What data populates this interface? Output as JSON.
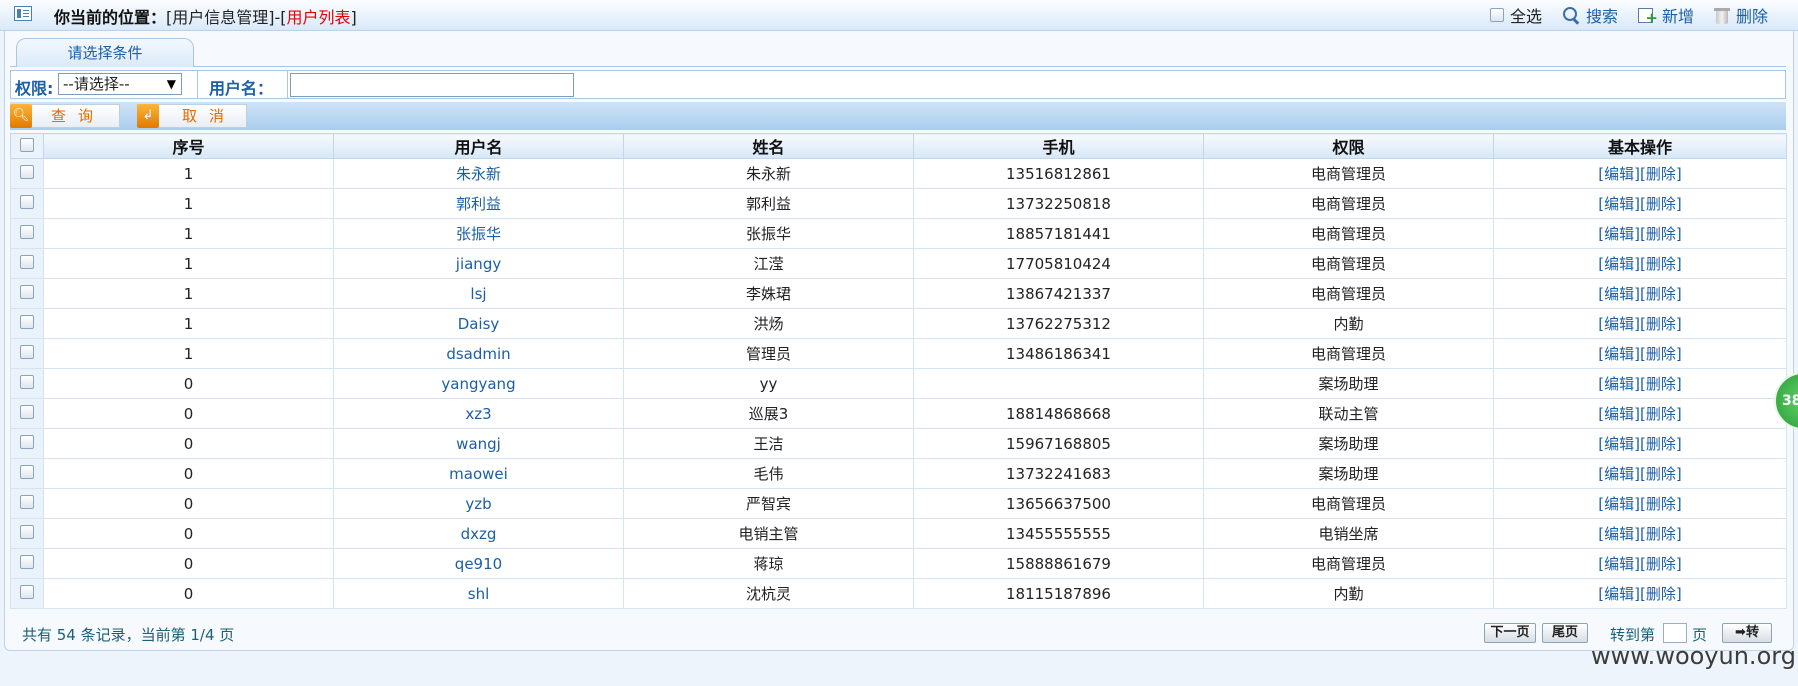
{
  "breadcrumb": {
    "prefix": "你当前的位置：",
    "path": "[用户信息管理]-[",
    "current": "用户列表",
    "suffix": "]"
  },
  "toolbar": {
    "select_all": "全选",
    "search": "搜索",
    "add": "新增",
    "delete": "删除"
  },
  "filter_panel": {
    "tab_label": "请选择条件",
    "role_label": "权限:",
    "role_selected": "--请选择--",
    "username_label": "用户名：",
    "username_value": ""
  },
  "buttons": {
    "query": "查询",
    "cancel": "取消"
  },
  "table": {
    "headers": [
      "序号",
      "用户名",
      "姓名",
      "手机",
      "权限",
      "基本操作"
    ],
    "edit_label": "[编辑]",
    "delete_label": "[删除]",
    "rows": [
      {
        "seq": "1",
        "username": "朱永新",
        "name": "朱永新",
        "phone": "13516812861",
        "role": "电商管理员"
      },
      {
        "seq": "1",
        "username": "郭利益",
        "name": "郭利益",
        "phone": "13732250818",
        "role": "电商管理员"
      },
      {
        "seq": "1",
        "username": "张振华",
        "name": "张振华",
        "phone": "18857181441",
        "role": "电商管理员"
      },
      {
        "seq": "1",
        "username": "jiangy",
        "name": "江滢",
        "phone": "17705810424",
        "role": "电商管理员"
      },
      {
        "seq": "1",
        "username": "lsj",
        "name": "李姝珺",
        "phone": "13867421337",
        "role": "电商管理员"
      },
      {
        "seq": "1",
        "username": "Daisy",
        "name": "洪炀",
        "phone": "13762275312",
        "role": "内勤"
      },
      {
        "seq": "1",
        "username": "dsadmin",
        "name": "管理员",
        "phone": "13486186341",
        "role": "电商管理员"
      },
      {
        "seq": "0",
        "username": "yangyang",
        "name": "yy",
        "phone": "",
        "role": "案场助理"
      },
      {
        "seq": "0",
        "username": "xz3",
        "name": "巡展3",
        "phone": "18814868668",
        "role": "联动主管"
      },
      {
        "seq": "0",
        "username": "wangj",
        "name": "王洁",
        "phone": "15967168805",
        "role": "案场助理"
      },
      {
        "seq": "0",
        "username": "maowei",
        "name": "毛伟",
        "phone": "13732241683",
        "role": "案场助理"
      },
      {
        "seq": "0",
        "username": "yzb",
        "name": "严智宾",
        "phone": "13656637500",
        "role": "电商管理员"
      },
      {
        "seq": "0",
        "username": "dxzg",
        "name": "电销主管",
        "phone": "13455555555",
        "role": "电销坐席"
      },
      {
        "seq": "0",
        "username": "qe910",
        "name": "蒋琼",
        "phone": "15888861679",
        "role": "电商管理员"
      },
      {
        "seq": "0",
        "username": "shl",
        "name": "沈杭灵",
        "phone": "18115187896",
        "role": "内勤"
      }
    ]
  },
  "pager": {
    "summary": "共有 54 条记录，当前第 1/4 页",
    "next": "下一页",
    "last": "尾页",
    "goto_prefix": "转到第",
    "goto_suffix": "页",
    "go": "➡转"
  },
  "bubble_text": "38",
  "watermark": "www.wooyun.org"
}
